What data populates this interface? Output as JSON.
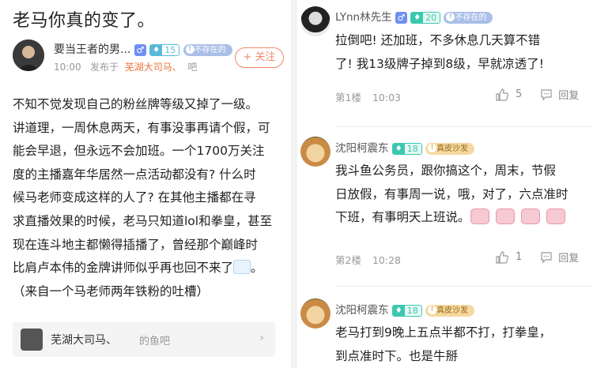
{
  "left_post": {
    "title": "老马你真的变了。",
    "author": "要当王者的男...",
    "gender_icon": "male-symbol",
    "level": "15",
    "status": "不存在的",
    "time": "10:00",
    "published_in_label": "发布于",
    "forum": "芜湖大司马、",
    "forum_suffix": "吧",
    "follow_label": "+ 关注",
    "body_lines": [
      "不知不觉发现自己的粉丝牌等级又掉了一级。",
      "讲道理，一周休息两天，有事没事再请个假，可",
      "能会早退，但永远不会加班。一个1700万关注",
      "度的主播嘉年华居然一点活动都没有? 什么时",
      "候马老师变成这样的人了? 在其他主播都在寻",
      "求直播效果的时候，老马只知道lol和拳皇，甚至",
      "现在连斗地主都懒得插播了，曾经那个巅峰时",
      "比肩卢本伟的金牌讲师似乎再也回不来了",
      "（来自一个马老师两年铁粉的吐槽）"
    ],
    "body_line8_end": "。",
    "source": {
      "name": "芜湖大司马、",
      "forum": "的鱼吧"
    }
  },
  "replies": [
    {
      "name": "LYnn林先生",
      "gender_icon": "male-symbol",
      "level": "20",
      "status": "不存在的",
      "lines": [
        "拉倒吧! 还加班，不多休息几天算不错",
        "了! 我13级牌子掉到8级，早就凉透了!"
      ],
      "floor": "第1楼",
      "time": "10:03",
      "likes": "5",
      "reply_label": "回复"
    },
    {
      "name": "沈阳柯震东",
      "level": "18",
      "status": "真皮沙发",
      "lines": [
        "我斗鱼公务员，跟你搞这个，周末，节假",
        "日放假，有事周一说，哦，对了，六点准时",
        "下班，有事明天上班说。"
      ],
      "floor": "第2楼",
      "time": "10:28",
      "likes": "1",
      "reply_label": "回复"
    },
    {
      "name": "沈阳柯震东",
      "level": "18",
      "status": "真皮沙发",
      "lines": [
        "老马打到9晚上五点半都不打，打拳皇，",
        "到点准时下。也是牛掰"
      ]
    }
  ],
  "colors": {
    "accent_orange": "#e8743b",
    "level_teal": "#3cc8b0",
    "level_blue": "#5ab9d9"
  }
}
